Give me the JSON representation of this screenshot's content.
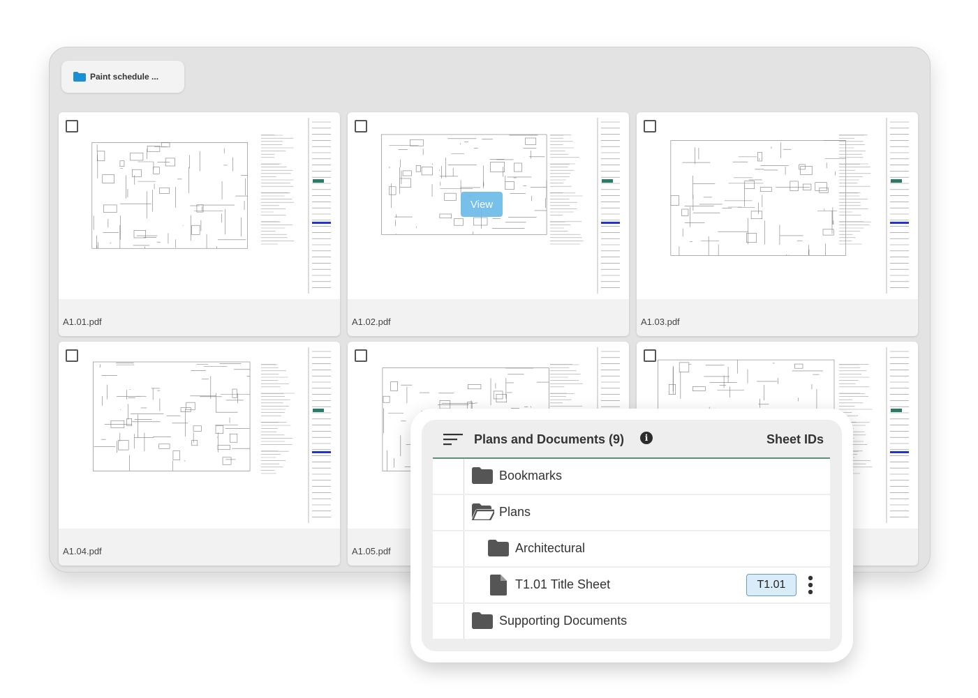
{
  "folder_tab": {
    "label": "Paint schedule ..."
  },
  "cards": [
    {
      "filename": "A1.01.pdf"
    },
    {
      "filename": "A1.02.pdf",
      "hover_label": "View"
    },
    {
      "filename": "A1.03.pdf"
    },
    {
      "filename": "A1.04.pdf"
    },
    {
      "filename": "A1.05.pdf"
    },
    {
      "filename": ""
    }
  ],
  "panel": {
    "title": "Plans and Documents (9)",
    "column_label": "Sheet IDs",
    "rows": [
      {
        "label": "Bookmarks",
        "icon": "folder-icon"
      },
      {
        "label": "Plans",
        "icon": "folder-open-icon"
      },
      {
        "label": "Architectural",
        "icon": "folder-icon"
      },
      {
        "label": "T1.01 Title Sheet",
        "icon": "document-icon",
        "sheet_id": "T1.01"
      },
      {
        "label": "Supporting Documents",
        "icon": "folder-icon"
      }
    ]
  },
  "colors": {
    "accent_green": "#5a9270",
    "badge_bg": "#d8ecf9",
    "view_button": "#6bbbe9",
    "folder_blue": "#1a8fd6"
  }
}
